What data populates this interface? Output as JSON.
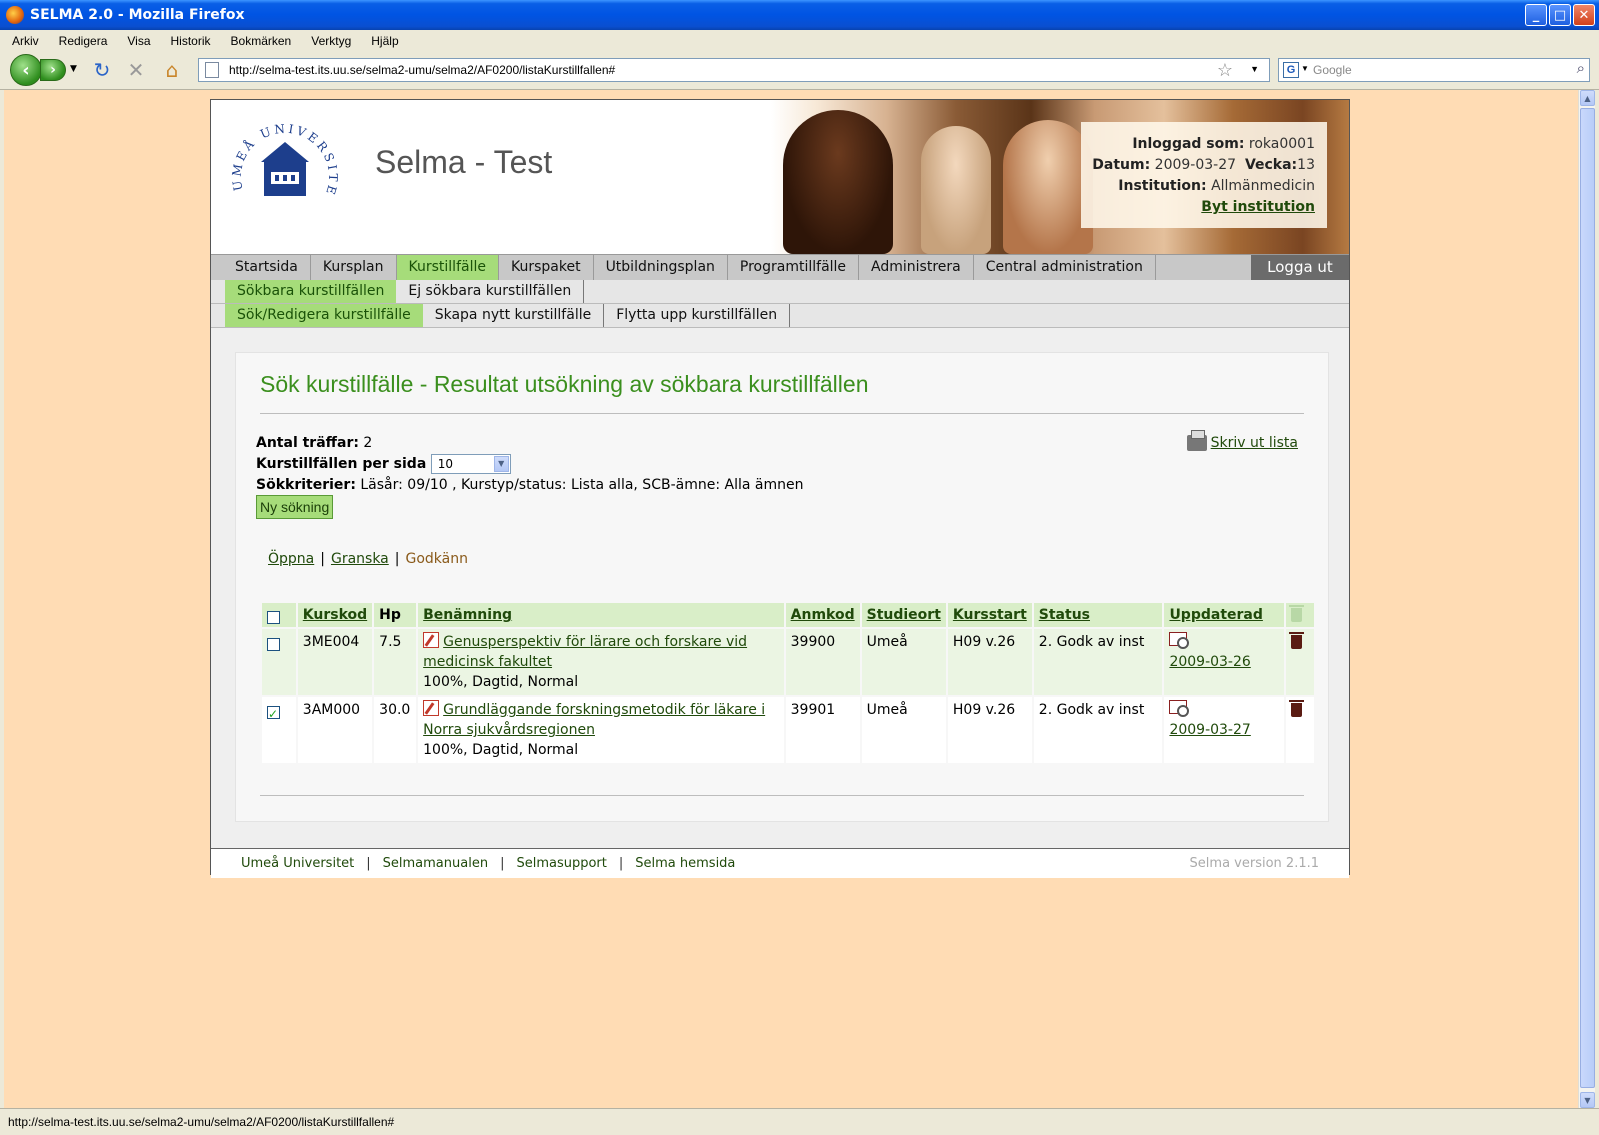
{
  "window": {
    "title": "SELMA 2.0 - Mozilla Firefox",
    "controls": [
      "_",
      "□",
      "✕"
    ]
  },
  "menubar": [
    "Arkiv",
    "Redigera",
    "Visa",
    "Historik",
    "Bokmärken",
    "Verktyg",
    "Hjälp"
  ],
  "browser": {
    "url": "http://selma-test.its.uu.se/selma2-umu/selma2/AF0200/listaKurstillfallen#",
    "search_placeholder": "Google",
    "status_text": "http://selma-test.its.uu.se/selma2-umu/selma2/AF0200/listaKurstillfallen#"
  },
  "header": {
    "site_title": "Selma - Test",
    "logo_text": "UMEÅ UNIVERSITET",
    "user_label": "Inloggad som:",
    "user_value": "roka0001",
    "date_label": "Datum:",
    "date_value": "2009-03-27",
    "week_label": "Vecka:",
    "week_value": "13",
    "institution_label": "Institution:",
    "institution_value": "Allmänmedicin",
    "change_institution": "Byt institution"
  },
  "main_nav": {
    "tabs": [
      "Startsida",
      "Kursplan",
      "Kurstillfälle",
      "Kurspaket",
      "Utbildningsplan",
      "Programtillfälle",
      "Administrera",
      "Central administration"
    ],
    "active": "Kurstillfälle",
    "logout": "Logga ut"
  },
  "sub_nav_1": {
    "tabs": [
      "Sökbara kurstillfällen",
      "Ej sökbara kurstillfällen"
    ],
    "active": "Sökbara kurstillfällen"
  },
  "sub_nav_2": {
    "tabs": [
      "Sök/Redigera kurstillfälle",
      "Skapa nytt kurstillfälle",
      "Flytta upp kurstillfällen"
    ],
    "active": "Sök/Redigera kurstillfälle"
  },
  "main": {
    "heading": "Sök kurstillfälle - Resultat utsökning av sökbara kurstillfällen",
    "hits_label": "Antal träffar:",
    "hits_value": "2",
    "per_page_label": "Kurstillfällen per sida",
    "per_page_value": "10",
    "criteria_label": "Sökkriterier:",
    "criteria_value": "Läsår: 09/10 , Kurstyp/status: Lista alla, SCB-ämne: Alla ämnen",
    "new_search": "Ny sökning",
    "print_list": " Skriv ut lista",
    "actions": {
      "open": "Öppna",
      "review": "Granska",
      "approve": "Godkänn",
      "separator": "|"
    }
  },
  "table": {
    "headers": [
      "Kurskod",
      "Hp",
      "Benämning",
      "Anmkod",
      "Studieort",
      "Kursstart",
      "Status",
      "Uppdaterad"
    ],
    "rows": [
      {
        "checked": false,
        "code": "3ME004",
        "hp": "7.5",
        "name": "Genusperspektiv för lärare och forskare vid medicinsk fakultet",
        "details": "100%, Dagtid, Normal",
        "anmkod": "39900",
        "location": "Umeå",
        "start": "H09 v.26",
        "status": "2. Godk av inst",
        "updated": "2009-03-26"
      },
      {
        "checked": true,
        "code": "3AM000",
        "hp": "30.0",
        "name": "Grundläggande forskningsmetodik för läkare i Norra sjukvårdsregionen",
        "details": "100%, Dagtid, Normal",
        "anmkod": "39901",
        "location": "Umeå",
        "start": "H09 v.26",
        "status": "2. Godk av inst",
        "updated": "2009-03-27"
      }
    ]
  },
  "footer": {
    "links": [
      "Umeå Universitet",
      "Selmamanualen",
      "Selmasupport",
      "Selma hemsida"
    ],
    "separator": "|",
    "version": "Selma version 2.1.1"
  },
  "colors": {
    "page_background": "#ffdcb4",
    "accent_green": "#a6dc7a",
    "heading_green": "#3b8f1e",
    "link_green": "#204a0b",
    "logout_bg": "#6b6b6b"
  }
}
